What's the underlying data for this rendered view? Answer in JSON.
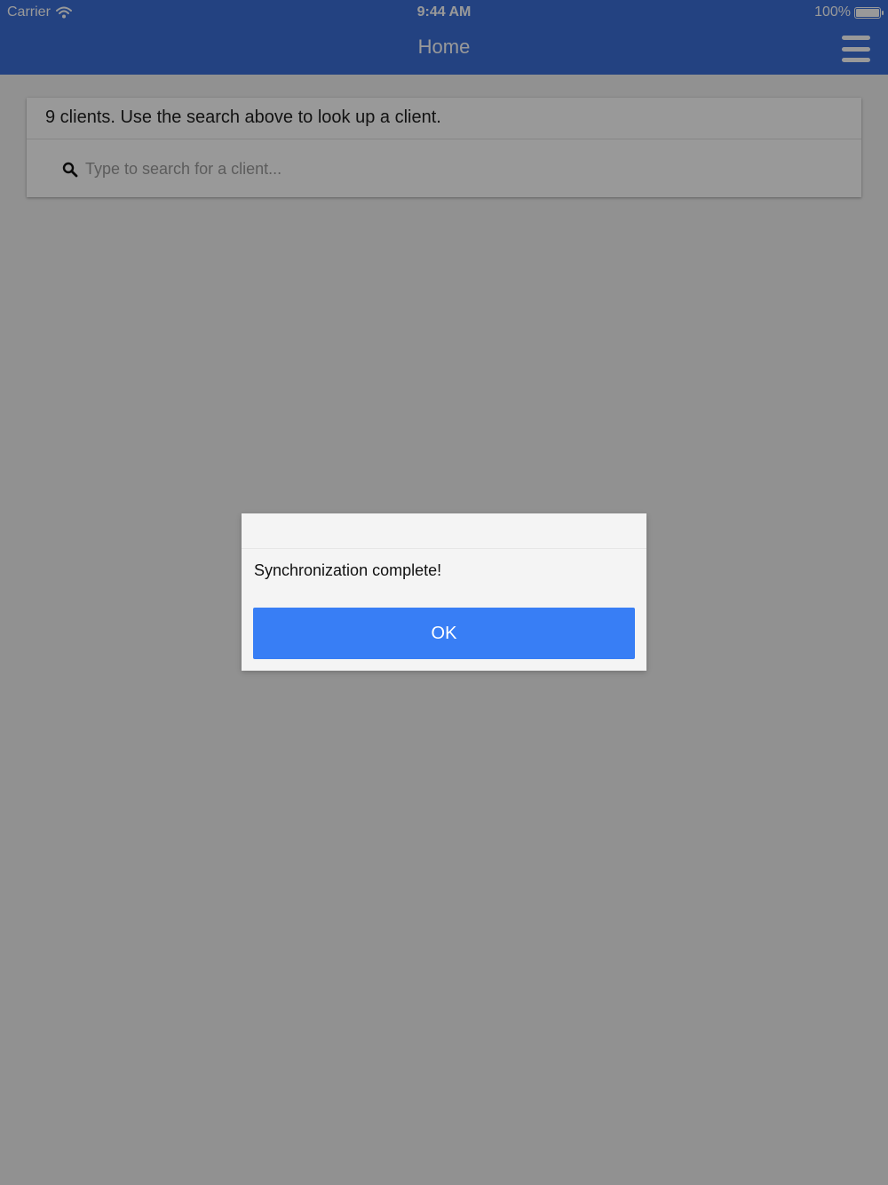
{
  "status_bar": {
    "carrier": "Carrier",
    "time": "9:44 AM",
    "battery": "100%"
  },
  "header": {
    "title": "Home",
    "menu_icon": "hamburger-menu-icon"
  },
  "clients_card": {
    "summary": "9 clients. Use the search above to look up a client.",
    "search": {
      "placeholder": "Type to search for a client...",
      "value": "",
      "icon": "search-icon"
    }
  },
  "alert": {
    "message": "Synchronization complete!",
    "ok_label": "OK"
  },
  "colors": {
    "header": "#3b6fd8",
    "ok_button": "#387ef5",
    "page_background": "#f2f2f2"
  }
}
